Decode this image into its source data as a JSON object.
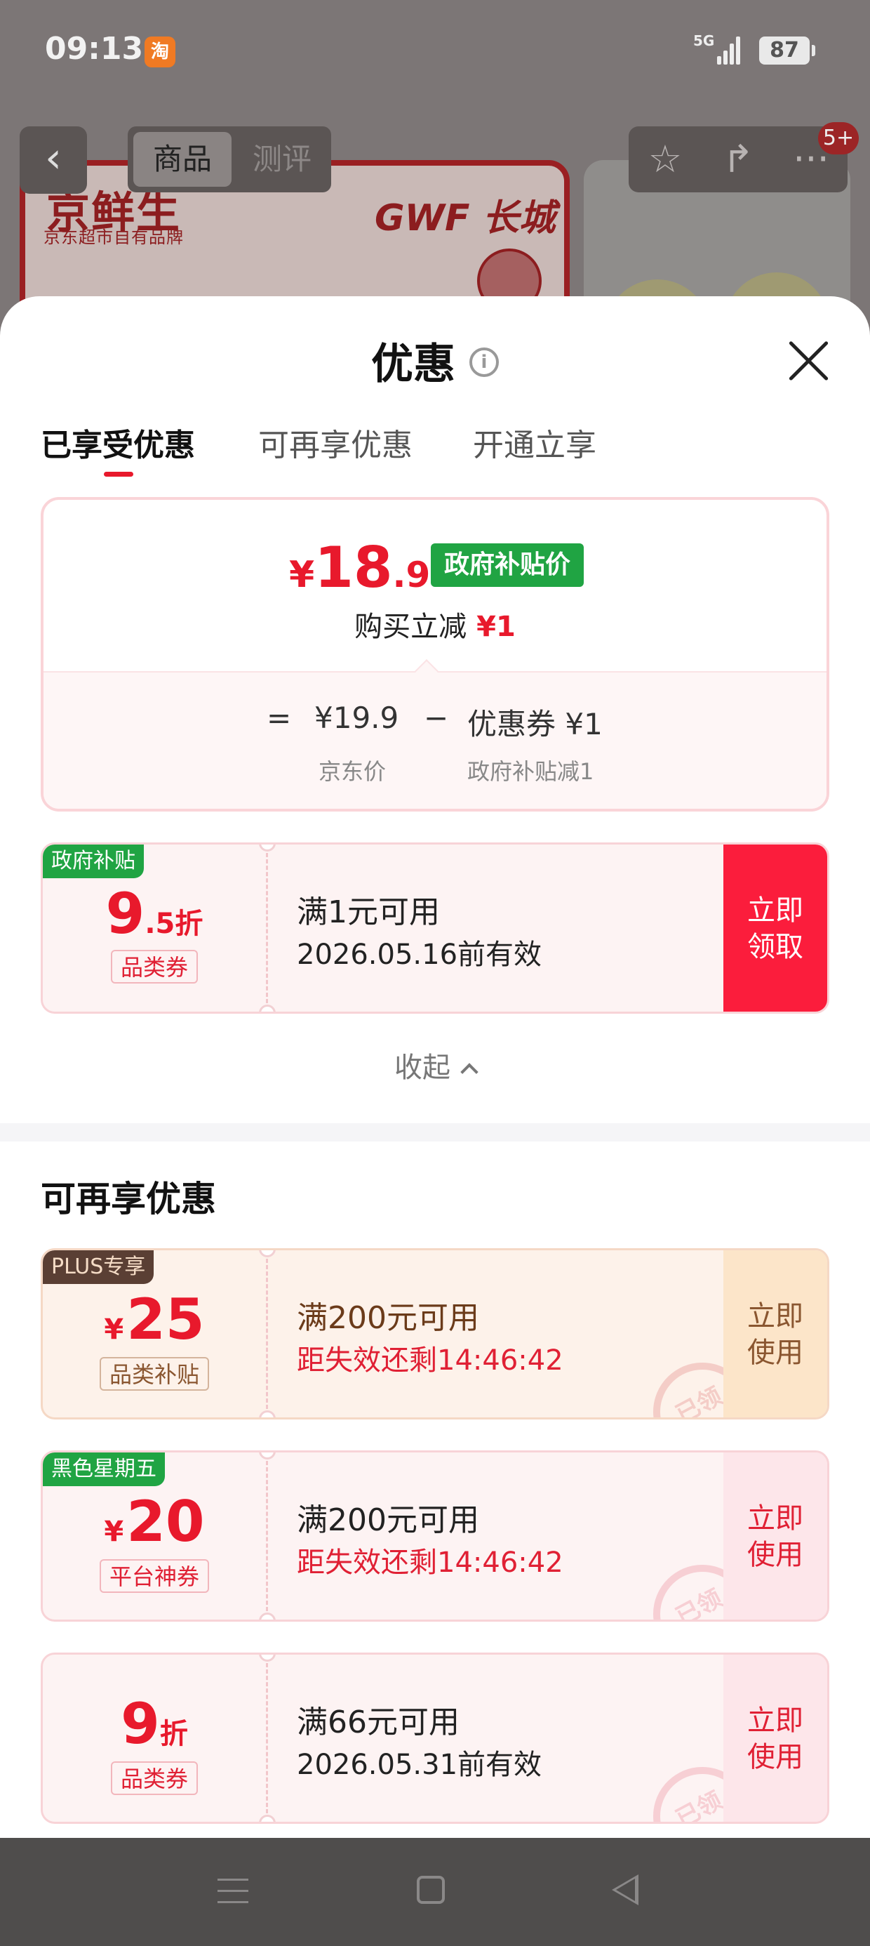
{
  "status_bar": {
    "time": "09:13",
    "app_icon": "淘",
    "network": "5G",
    "battery": "87"
  },
  "background_page": {
    "tabs": [
      "商品",
      "测评"
    ],
    "brand_name": "京鲜生",
    "brand_sub": "京东超市自有品牌",
    "logo_text": "GWF 长城",
    "badge": "5+",
    "icons": [
      "back-icon",
      "star-icon",
      "share-icon",
      "more-icon"
    ]
  },
  "sheet": {
    "title": "优惠",
    "tabs": [
      "已享受优惠",
      "可再享优惠",
      "开通立享"
    ],
    "summary": {
      "price_currency": "¥",
      "price_int": "18",
      "price_dec": ".9",
      "price_tag": "政府补贴价",
      "buy_reduce_label": "购买立减",
      "buy_reduce_amount": "¥1",
      "equals": "=",
      "jd_price": "¥19.9",
      "minus": "−",
      "coupon_reduce": "优惠券 ¥1",
      "jd_price_label": "京东价",
      "coupon_reduce_label": "政府补贴减1"
    },
    "applied_coupon": {
      "tag": "政府补贴",
      "amount_big": "9",
      "amount_small": ".5折",
      "type": "品类券",
      "condition": "满1元可用",
      "expiry": "2026.05.16前有效",
      "action": "立即领取"
    },
    "collapse_label": "收起",
    "more_section_title": "可再享优惠",
    "more_coupons": [
      {
        "tag": "PLUS专享",
        "currency": "¥",
        "amount": "25",
        "type": "品类补贴",
        "condition": "满200元可用",
        "expiry": "距失效还剩14:46:42",
        "action": "立即使用",
        "stamp": "已领"
      },
      {
        "tag": "黑色星期五",
        "currency": "¥",
        "amount": "20",
        "type": "平台神券",
        "condition": "满200元可用",
        "expiry": "距失效还剩14:46:42",
        "action": "立即使用",
        "stamp": "已领"
      },
      {
        "tag": "",
        "amount_big": "9",
        "amount_small": "折",
        "type": "品类券",
        "condition": "满66元可用",
        "expiry": "2026.05.31前有效",
        "action": "立即使用",
        "stamp": "已领"
      }
    ]
  },
  "colors": {
    "accent_red": "#e8192c",
    "gov_green": "#20a443",
    "plus_brown": "#5a3f34"
  }
}
